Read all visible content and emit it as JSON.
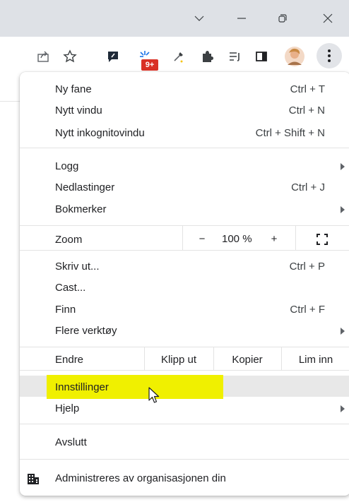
{
  "colors": {
    "titlebar": "#dee1e6",
    "menu_bg": "#ffffff",
    "hover_row": "#e8e8e8",
    "highlight_marker": "#f0f000",
    "badge": "#d93025",
    "extension_icon_blue": "#1a73e8"
  },
  "window_controls": {
    "dropdown_icon": "chevron-down-icon",
    "minimize_icon": "minimize-icon",
    "restore_icon": "restore-icon",
    "close_icon": "close-icon"
  },
  "toolbar": {
    "badge_text": "9+",
    "icons": [
      "share-icon",
      "star-icon",
      "chat-extension-icon",
      "star-extension-icon",
      "eyedropper-icon",
      "puzzle-extensions-icon",
      "reading-list-icon",
      "side-panel-icon",
      "profile-avatar",
      "more-menu-icon"
    ]
  },
  "menu": {
    "new_tab": {
      "label": "Ny fane",
      "shortcut": "Ctrl + T"
    },
    "new_window": {
      "label": "Nytt vindu",
      "shortcut": "Ctrl + N"
    },
    "incognito": {
      "label": "Nytt inkognitovindu",
      "shortcut": "Ctrl + Shift + N"
    },
    "history": {
      "label": "Logg"
    },
    "downloads": {
      "label": "Nedlastinger",
      "shortcut": "Ctrl + J"
    },
    "bookmarks": {
      "label": "Bokmerker"
    },
    "zoom": {
      "label": "Zoom",
      "minus": "−",
      "value": "100 %",
      "plus": "+",
      "fullscreen_icon": "fullscreen-icon"
    },
    "print": {
      "label": "Skriv ut...",
      "shortcut": "Ctrl + P"
    },
    "cast": {
      "label": "Cast..."
    },
    "find": {
      "label": "Finn",
      "shortcut": "Ctrl + F"
    },
    "more_tools": {
      "label": "Flere verktøy"
    },
    "edit": {
      "label": "Endre",
      "cut": "Klipp ut",
      "copy": "Kopier",
      "paste": "Lim inn"
    },
    "settings": {
      "label": "Innstillinger"
    },
    "help": {
      "label": "Hjelp"
    },
    "exit": {
      "label": "Avslutt"
    },
    "managed": {
      "label": "Administreres av organisasjonen din",
      "icon": "building-icon"
    }
  }
}
